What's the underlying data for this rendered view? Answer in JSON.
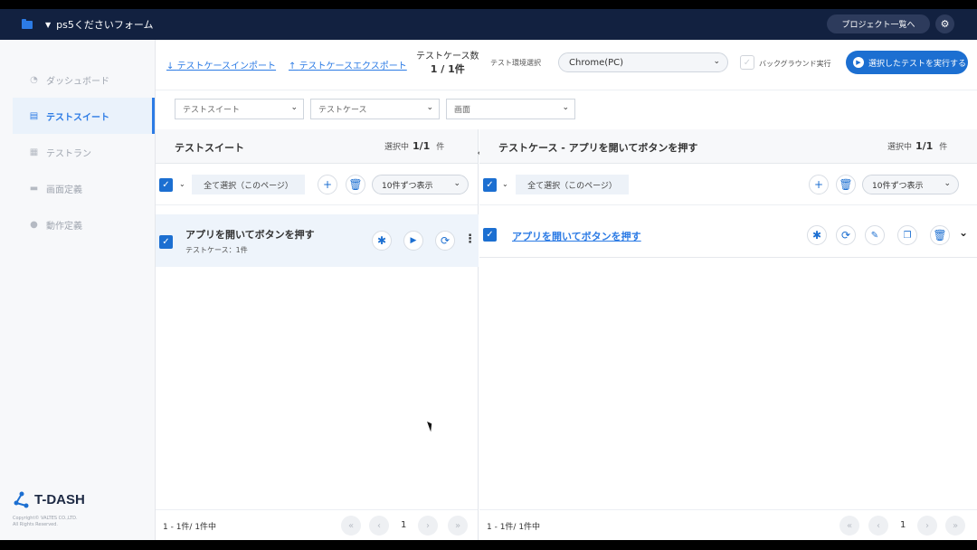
{
  "topbar": {
    "project_name": "ps5くださいフォーム",
    "project_list_label": "プロジェクト一覧へ",
    "settings_icon": "gear-icon"
  },
  "sidebar": {
    "items": [
      {
        "label": "ダッシュボード",
        "icon": "pie-chart-icon",
        "active": false
      },
      {
        "label": "テストスイート",
        "icon": "document-icon",
        "active": true
      },
      {
        "label": "テストラン",
        "icon": "list-icon",
        "active": false
      },
      {
        "label": "画面定義",
        "icon": "monitor-icon",
        "active": false
      },
      {
        "label": "動作定義",
        "icon": "check-circle-icon",
        "active": false
      }
    ],
    "logo_text": "T-DASH",
    "copyright_line1": "Copyright© VALTES CO.,LTD.",
    "copyright_line2": "All Rights Reserved."
  },
  "toolbar": {
    "import_label": "テストケースインポート",
    "export_label": "テストケースエクスポート",
    "count_label": "テストケース数",
    "count_value": "1 / 1件",
    "env_label": "テスト環境選択",
    "env_value": "Chrome(PC)",
    "background_label": "バックグラウンド実行",
    "run_label": "選択したテストを実行する"
  },
  "filters": {
    "suite_placeholder": "テストスイート",
    "case_placeholder": "テストケース",
    "screen_placeholder": "画面"
  },
  "left_panel": {
    "title": "テストスイート",
    "selected_label": "選択中",
    "selected_value": "1/1",
    "selected_unit": "件",
    "select_all_label": "全て選択（このページ）",
    "page_size": "10件ずつ表示",
    "suite": {
      "title": "アプリを開いてボタンを押す",
      "subtitle": "テストケース：1件"
    },
    "footer_info": "1 - 1件/ 1件中",
    "page": "1"
  },
  "right_panel": {
    "title": "テストケース - アプリを開いてボタンを押す",
    "selected_label": "選択中",
    "selected_value": "1/1",
    "selected_unit": "件",
    "select_all_label": "全て選択（このページ）",
    "page_size": "10件ずつ表示",
    "case": {
      "title": "アプリを開いてボタンを押す"
    },
    "footer_info": "1 - 1件/ 1件中",
    "page": "1"
  },
  "colors": {
    "accent": "#1c6fd1",
    "topbar": "#122140"
  }
}
